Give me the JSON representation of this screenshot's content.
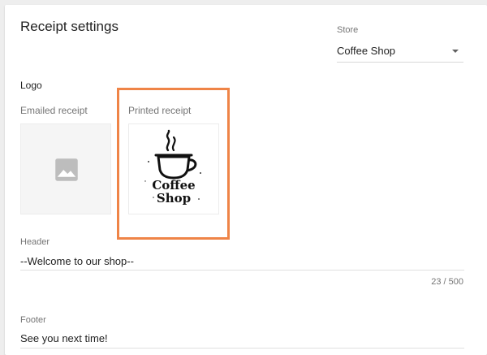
{
  "page": {
    "title": "Receipt settings"
  },
  "store": {
    "label": "Store",
    "selected": "Coffee Shop"
  },
  "logo": {
    "section_title": "Logo",
    "emailed_label": "Emailed receipt",
    "emailed_icon": "image-placeholder-icon",
    "printed_label": "Printed receipt",
    "printed_logo_line1": "Coffee",
    "printed_logo_line2": "Shop",
    "highlight_color": "#ef8447"
  },
  "header": {
    "label": "Header",
    "value": "--Welcome to our shop--",
    "counter": "23 / 500"
  },
  "footer": {
    "label": "Footer",
    "value": "See you next time!"
  }
}
